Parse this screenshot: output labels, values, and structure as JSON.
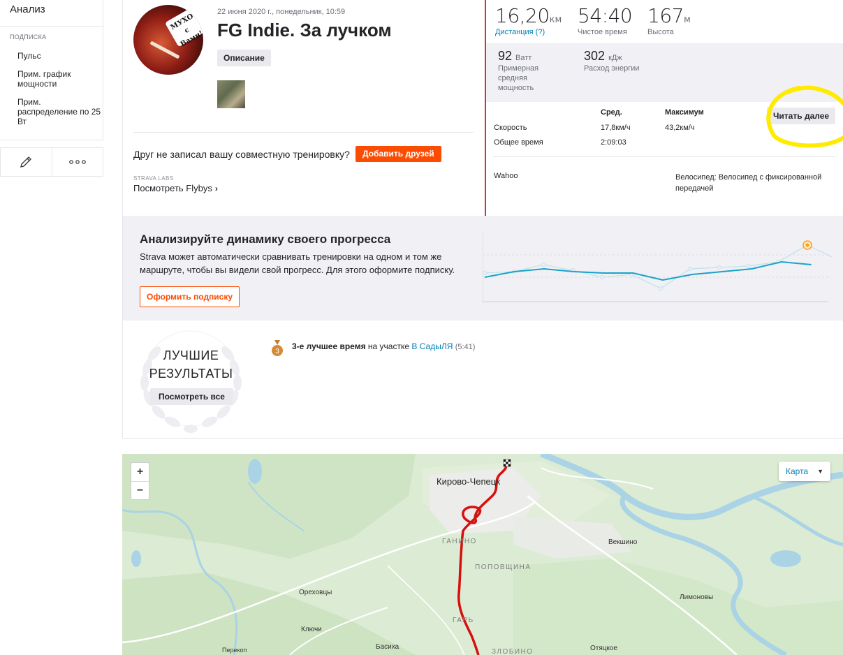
{
  "sidebar": {
    "analysis_label": "Анализ",
    "section_label": "Подписка",
    "items": [
      {
        "label": "Пульс"
      },
      {
        "label": "Прим. график мощности"
      },
      {
        "label": "Прим. распределение по 25 Вт"
      }
    ],
    "edit_icon": "pencil-icon",
    "more_icon": "more-dots-icon"
  },
  "activity": {
    "date": "22 июня 2020 г., понедельник, 10:59",
    "title": "FG Indie. За лучком",
    "description_button": "Описание",
    "avatar_sign_text": "МУХО с Вами!",
    "friend_prompt": "Друг не записал вашу совместную тренировку?",
    "add_friends_button": "Добавить друзей",
    "labs_label": "STRAVA LABS",
    "flybys_link": "Посмотреть Flybys"
  },
  "stats": {
    "distance": {
      "value": "16,20",
      "unit": "км",
      "label": "Дистанция (?)"
    },
    "moving_time": {
      "value": "54:40",
      "label": "Чистое время"
    },
    "elevation": {
      "value": "167",
      "unit": "м",
      "label": "Высота"
    },
    "power": {
      "value": "92",
      "unit": "Ватт",
      "label": "Примерная средняя мощность"
    },
    "energy": {
      "value": "302",
      "unit": "кДж",
      "label": "Расход энергии"
    },
    "table": {
      "col_avg": "Сред.",
      "col_max": "Максимум",
      "rows": [
        {
          "label": "Скорость",
          "avg": "17,8км/ч",
          "max": "43,2км/ч"
        },
        {
          "label": "Общее время",
          "avg": "2:09:03",
          "max": ""
        }
      ]
    },
    "read_more_button": "Читать далее",
    "device": "Wahoo",
    "bike": "Велосипед: Велосипед с фиксированной передачей",
    "highlight_color": "#ffeb00"
  },
  "upsell": {
    "title": "Анализируйте динамику своего прогресса",
    "text": "Strava может автоматически сравнивать тренировки на одном и том же маршруте, чтобы вы видели свой прогресс. Для этого оформите подписку.",
    "button": "Оформить подписку",
    "series_main": [
      41,
      45,
      47,
      45,
      44,
      44,
      39,
      43,
      45,
      47,
      52,
      50
    ],
    "series_faint": [
      44,
      45,
      50,
      46,
      41,
      43,
      33,
      47,
      48,
      49,
      52,
      64,
      54
    ],
    "highlight_color": "#f7a21e",
    "line_color": "#1aa3c7"
  },
  "best": {
    "title": "ЛУЧШИЕ РЕЗУЛЬТАТЫ",
    "button": "Посмотреть все",
    "medal_rank": "3",
    "line_rank": "3-е лучшее время",
    "line_mid": "на участке",
    "segment": "В СадыЛЯ",
    "time": "(5:41)"
  },
  "map": {
    "zoom_in": "+",
    "zoom_out": "−",
    "type_button": "Карта",
    "route_color": "#d60f0f",
    "labels": {
      "kirovo": "Кирово-Чепецк",
      "ganino": "ГАНИНО",
      "popovshchina": "ПОПОВЩИНА",
      "vekshino": "Векшино",
      "orekhovtsy": "Ореховцы",
      "limonovy": "Лимоновы",
      "gar": "ГАРЬ",
      "klyuchi": "Ключи",
      "basikha": "Басиха",
      "perekop": "Перекоп",
      "zlobino": "ЗЛОБИНО",
      "otyatskoe": "Отяцкое"
    }
  }
}
